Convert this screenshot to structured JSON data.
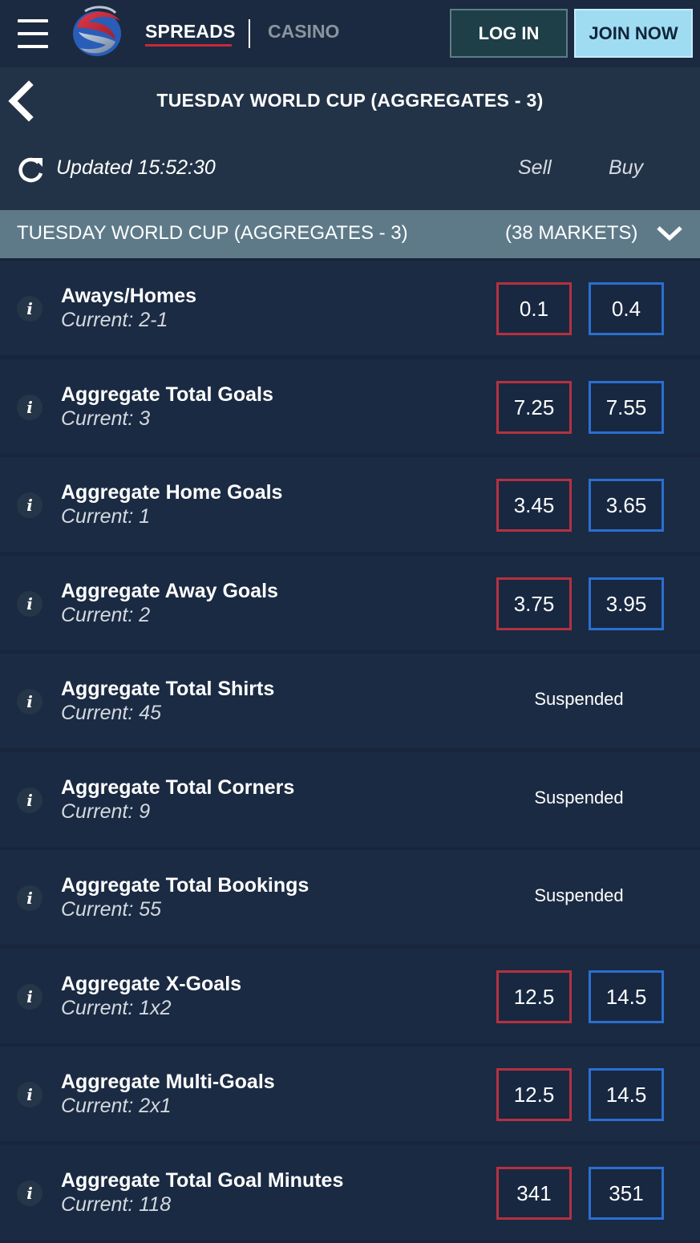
{
  "nav": {
    "spreads_label": "SPREADS",
    "casino_label": "CASINO",
    "login_label": "LOG IN",
    "join_label": "JOIN NOW"
  },
  "header": {
    "title": "TUESDAY WORLD CUP (AGGREGATES - 3)"
  },
  "updates": {
    "text": "Updated 15:52:30",
    "sell_label": "Sell",
    "buy_label": "Buy"
  },
  "section": {
    "title": "TUESDAY WORLD CUP (AGGREGATES - 3)",
    "count": "(38 MARKETS)"
  },
  "markets": [
    {
      "name": "Aways/Homes",
      "current": "Current: 2-1",
      "sell": "0.1",
      "buy": "0.4",
      "status": ""
    },
    {
      "name": "Aggregate Total Goals",
      "current": "Current: 3",
      "sell": "7.25",
      "buy": "7.55",
      "status": ""
    },
    {
      "name": "Aggregate Home Goals",
      "current": "Current: 1",
      "sell": "3.45",
      "buy": "3.65",
      "status": ""
    },
    {
      "name": "Aggregate Away Goals",
      "current": "Current: 2",
      "sell": "3.75",
      "buy": "3.95",
      "status": ""
    },
    {
      "name": "Aggregate Total Shirts",
      "current": "Current: 45",
      "sell": "",
      "buy": "",
      "status": "Suspended"
    },
    {
      "name": "Aggregate Total Corners",
      "current": "Current: 9",
      "sell": "",
      "buy": "",
      "status": "Suspended"
    },
    {
      "name": "Aggregate Total Bookings",
      "current": "Current: 55",
      "sell": "",
      "buy": "",
      "status": "Suspended"
    },
    {
      "name": "Aggregate X-Goals",
      "current": "Current: 1x2",
      "sell": "12.5",
      "buy": "14.5",
      "status": ""
    },
    {
      "name": "Aggregate Multi-Goals",
      "current": "Current: 2x1",
      "sell": "12.5",
      "buy": "14.5",
      "status": ""
    },
    {
      "name": "Aggregate Total Goal Minutes",
      "current": "Current: 118",
      "sell": "341",
      "buy": "351",
      "status": ""
    }
  ],
  "info_glyph": "i",
  "colors": {
    "sell_border": "#b53140",
    "buy_border": "#2a6fd0",
    "join_button": "#9fdcf2",
    "section_header": "#5e7a89"
  }
}
